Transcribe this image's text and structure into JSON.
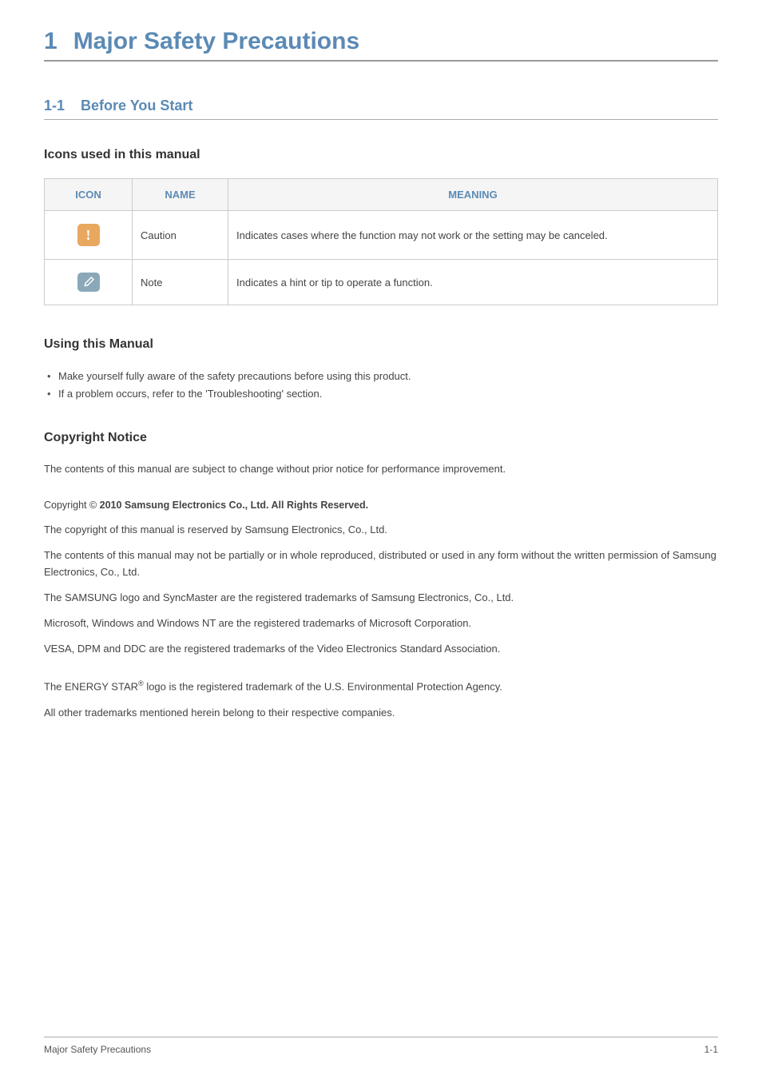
{
  "chapter": {
    "num": "1",
    "title": "Major Safety Precautions"
  },
  "section": {
    "num": "1-1",
    "title": "Before You Start"
  },
  "subsection_icons_title": "Icons used in this manual",
  "table": {
    "headers": {
      "icon": "ICON",
      "name": "NAME",
      "meaning": "MEANING"
    },
    "rows": [
      {
        "name": "Caution",
        "meaning": "Indicates cases where the function may not work or the setting may be canceled."
      },
      {
        "name": "Note",
        "meaning": "Indicates a hint or tip to operate a function."
      }
    ]
  },
  "using_manual": {
    "title": "Using this Manual",
    "items": [
      "Make yourself fully aware of the safety precautions before using this product.",
      "If a problem occurs, refer to the 'Troubleshooting' section."
    ]
  },
  "copyright_notice": {
    "title": "Copyright Notice",
    "intro": "The contents of this manual are subject to change without prior notice for performance improvement.",
    "copyright_prefix": "Copyright © ",
    "copyright_bold": " 2010 Samsung Electronics Co., Ltd. All Rights Reserved.",
    "paras": [
      "The copyright of this manual is reserved by Samsung Electronics, Co., Ltd.",
      "The contents of this manual may not be partially or in whole reproduced, distributed or used in any form without the written permission of Samsung Electronics, Co., Ltd.",
      "The SAMSUNG logo and SyncMaster are the registered trademarks of Samsung Electronics, Co., Ltd.",
      "Microsoft, Windows and Windows NT are the registered trademarks of Microsoft Corporation.",
      "VESA, DPM and DDC are the registered trademarks of the Video Electronics Standard Association."
    ],
    "energy_star_pre": "The ENERGY STAR",
    "energy_star_sup": "®",
    "energy_star_post": " logo is the registered trademark of the U.S. Environmental Protection Agency.",
    "all_other": "All other trademarks mentioned herein belong to their respective companies."
  },
  "footer": {
    "left": "Major Safety Precautions",
    "right": "1-1"
  }
}
